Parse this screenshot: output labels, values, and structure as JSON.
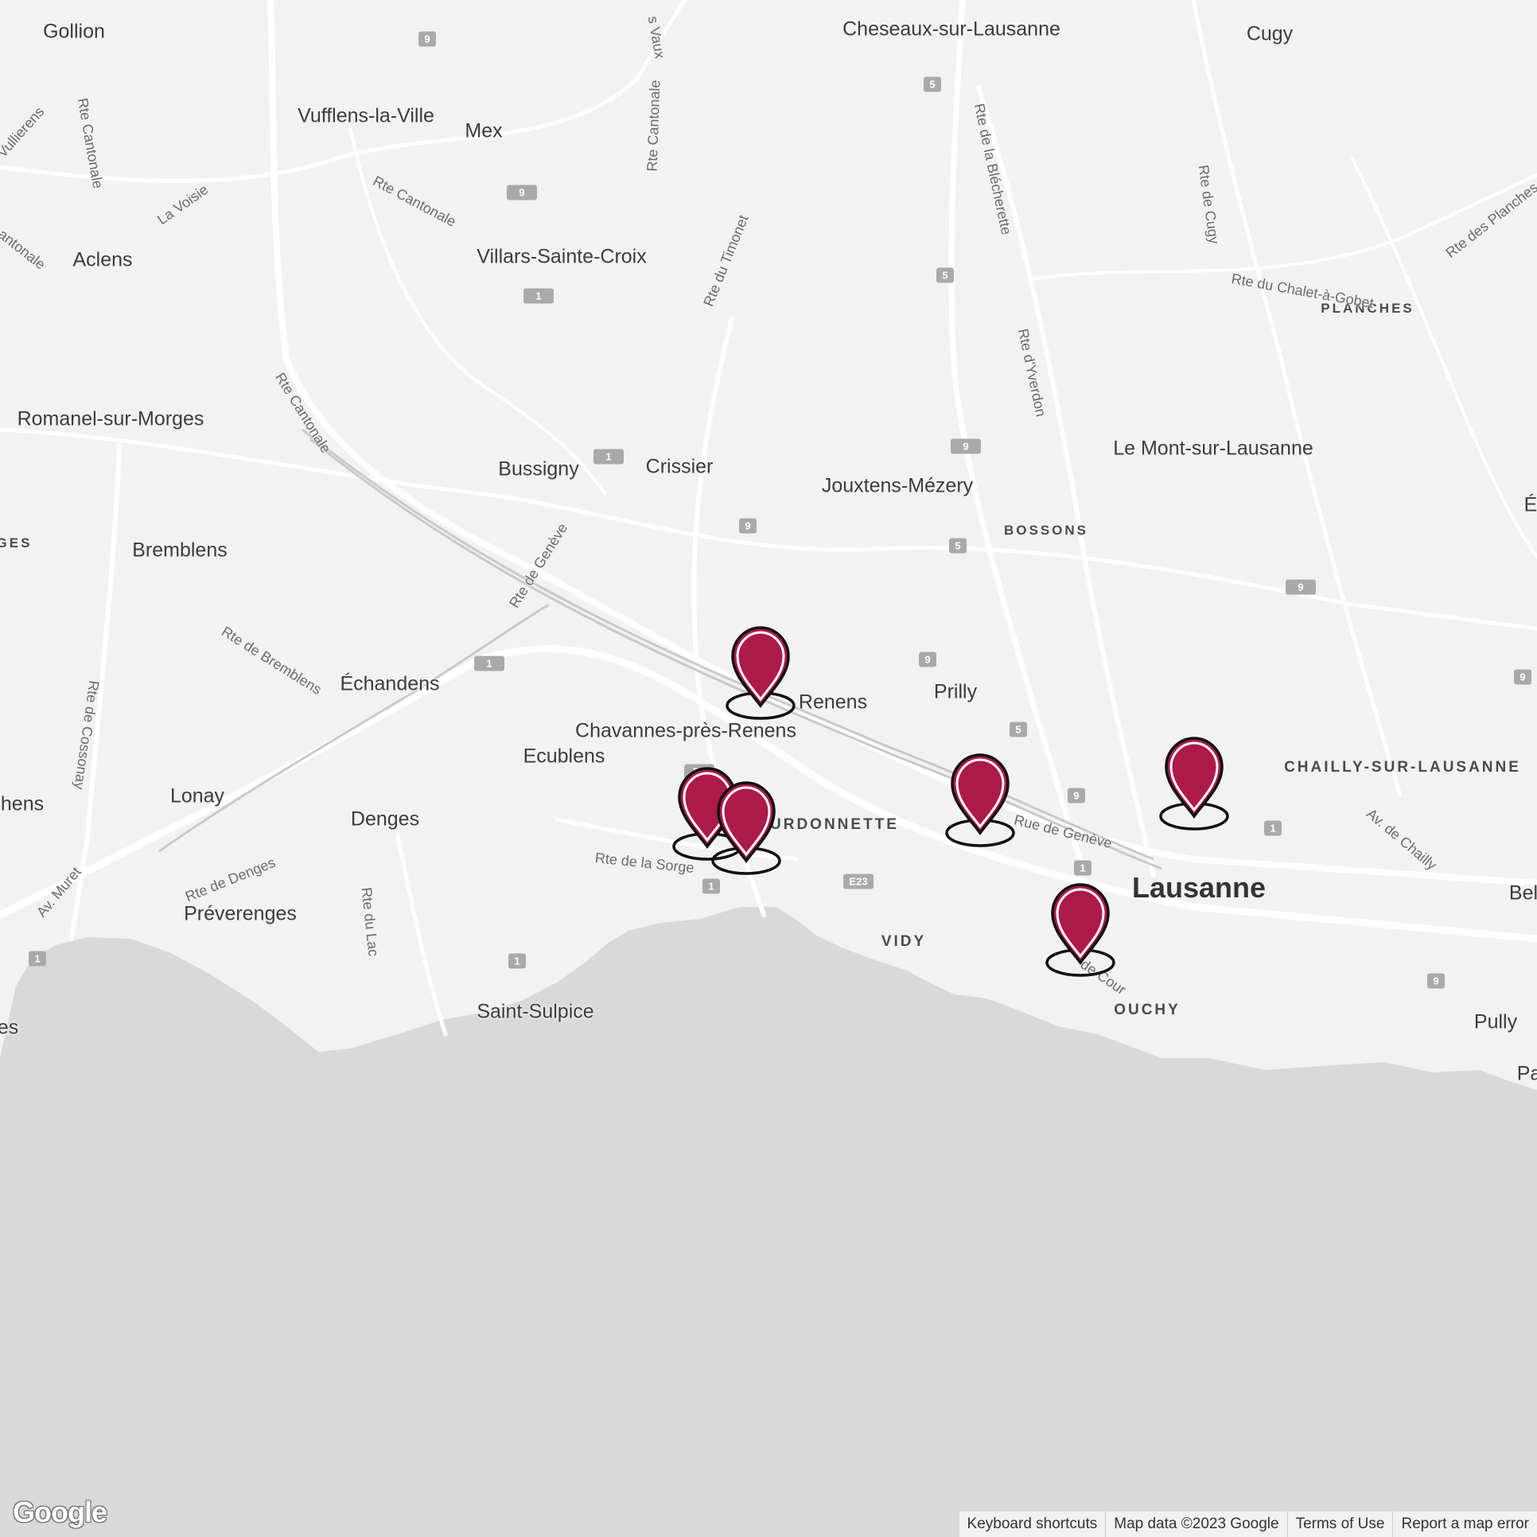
{
  "map": {
    "land_color": "#f2f2f2",
    "water_color": "#d9d9d9",
    "road_color": "#ffffff",
    "marker_color": "#ad1a4a",
    "places": [
      {
        "name": "Gollion",
        "kind": "town"
      },
      {
        "name": "Vufflens-la-Ville",
        "kind": "town"
      },
      {
        "name": "Mex",
        "kind": "town"
      },
      {
        "name": "Cheseaux-sur-Lausanne",
        "kind": "town"
      },
      {
        "name": "Cugy",
        "kind": "town"
      },
      {
        "name": "Aclens",
        "kind": "town"
      },
      {
        "name": "Villars-Sainte-Croix",
        "kind": "town"
      },
      {
        "name": "PLANCHES",
        "kind": "district"
      },
      {
        "name": "Romanel-sur-Morges",
        "kind": "town"
      },
      {
        "name": "Bussigny",
        "kind": "town"
      },
      {
        "name": "Crissier",
        "kind": "town"
      },
      {
        "name": "Jouxtens-Mézery",
        "kind": "town"
      },
      {
        "name": "Le Mont-sur-Lausanne",
        "kind": "town"
      },
      {
        "name": "BOSSONS",
        "kind": "district"
      },
      {
        "name": "GES",
        "kind": "district"
      },
      {
        "name": "Bremblens",
        "kind": "town"
      },
      {
        "name": "Échandens",
        "kind": "town"
      },
      {
        "name": "Renens",
        "kind": "town"
      },
      {
        "name": "Prilly",
        "kind": "town"
      },
      {
        "name": "Chavannes-près-Renens",
        "kind": "town"
      },
      {
        "name": "Ecublens",
        "kind": "town"
      },
      {
        "name": "CHAILLY-SUR-LAUSANNE",
        "kind": "district"
      },
      {
        "name": "hens",
        "kind": "town"
      },
      {
        "name": "Lonay",
        "kind": "town"
      },
      {
        "name": "Denges",
        "kind": "town"
      },
      {
        "name": "URDONNETTE",
        "kind": "district"
      },
      {
        "name": "Lausanne",
        "kind": "city"
      },
      {
        "name": "Bel",
        "kind": "town"
      },
      {
        "name": "Préverenges",
        "kind": "town"
      },
      {
        "name": "VIDY",
        "kind": "district"
      },
      {
        "name": "Saint-Sulpice",
        "kind": "town"
      },
      {
        "name": "OUCHY",
        "kind": "district"
      },
      {
        "name": "Pully",
        "kind": "town"
      },
      {
        "name": "es",
        "kind": "town"
      },
      {
        "name": "É",
        "kind": "town"
      },
      {
        "name": "Pa",
        "kind": "town"
      }
    ],
    "roads": [
      "Rte Cantonale",
      "Rte Cantonale",
      "Rte Cantonale",
      "Rte Cantonale",
      "La Voisie",
      "Vullierens",
      "antonale",
      "Rte du Timonet",
      "Rte de la Blécherette",
      "Rte de Cugy",
      "Rte du Chalet-à-Gobet",
      "Rte des Planches",
      "Rte d'Yverdon",
      "Rte de Genève",
      "Rte de Bremblens",
      "Rte de Cossonay",
      "Av. Muret",
      "Rte de Denges",
      "Rte du Lac",
      "Rte de la Sorge",
      "Rue de Genève",
      "Av. de Chailly",
      "de Cour",
      "s Vaux"
    ],
    "shields": [
      "9",
      "9",
      "1",
      "5",
      "5",
      "1",
      "9",
      "9",
      "5",
      "9",
      "9",
      "1",
      "5",
      "9",
      "1",
      "1",
      "E23",
      "1",
      "1",
      "1",
      "9",
      "9",
      "E2"
    ],
    "markers": [
      "location-1",
      "location-2",
      "location-3",
      "location-4",
      "location-5",
      "location-6"
    ]
  },
  "branding": {
    "logo": "Google"
  },
  "attribution": {
    "shortcuts": "Keyboard shortcuts",
    "map_data": "Map data ©2023 Google",
    "terms": "Terms of Use",
    "report": "Report a map error"
  }
}
